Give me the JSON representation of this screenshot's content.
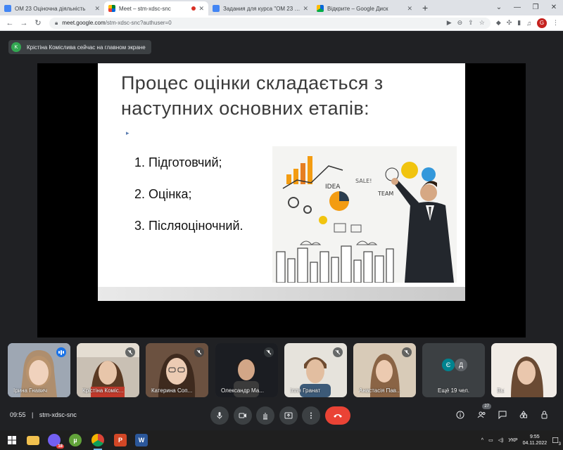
{
  "browser": {
    "tabs": [
      {
        "title": "ОМ 23 Оціночна діяльність",
        "color": "#4285f4"
      },
      {
        "title": "Meet – stm-xdsc-snc",
        "color": "#00897b",
        "active": true,
        "recording": true
      },
      {
        "title": "Задания для курса \"ОМ 23 Оцін",
        "color": "#4285f4"
      },
      {
        "title": "Відкрите – Google Диск",
        "color": "#fbbc04"
      }
    ],
    "url_host": "meet.google.com",
    "url_path": "/stm-xdsc-snc?authuser=0",
    "profile_initial": "G"
  },
  "notification": {
    "avatar_initial": "K",
    "text": "Крістіна Коміслива сейчас на главном экране"
  },
  "slide": {
    "title_line1": "Процес оцінки складається з",
    "title_line2": "наступних основних етапів:",
    "bullet": "▸",
    "items": [
      "1. Підготовчий;",
      "2. Оцінка;",
      "3. Післяоціночний."
    ]
  },
  "participants": [
    {
      "name": "Ірина Гнавич",
      "speaking": true,
      "muted": false
    },
    {
      "name": "Крістіна Коміс...",
      "muted": true
    },
    {
      "name": "Катерина Соп...",
      "muted": true
    },
    {
      "name": "Олександр Ма...",
      "muted": true
    },
    {
      "name": "Ілля Гранат",
      "muted": true
    },
    {
      "name": "Анастасія Пав...",
      "muted": true
    },
    {
      "name": "Ещё 19 чел.",
      "avatars": [
        "Є",
        "Д"
      ]
    },
    {
      "name": "Вы"
    }
  ],
  "controls": {
    "time": "09:55",
    "separator": "|",
    "meeting_code": "stm-xdsc-snc",
    "people_count": "27"
  },
  "taskbar": {
    "language": "УКР",
    "time": "9:55",
    "date": "04.11.2022",
    "notifications": "3",
    "viber_badge": "18"
  }
}
